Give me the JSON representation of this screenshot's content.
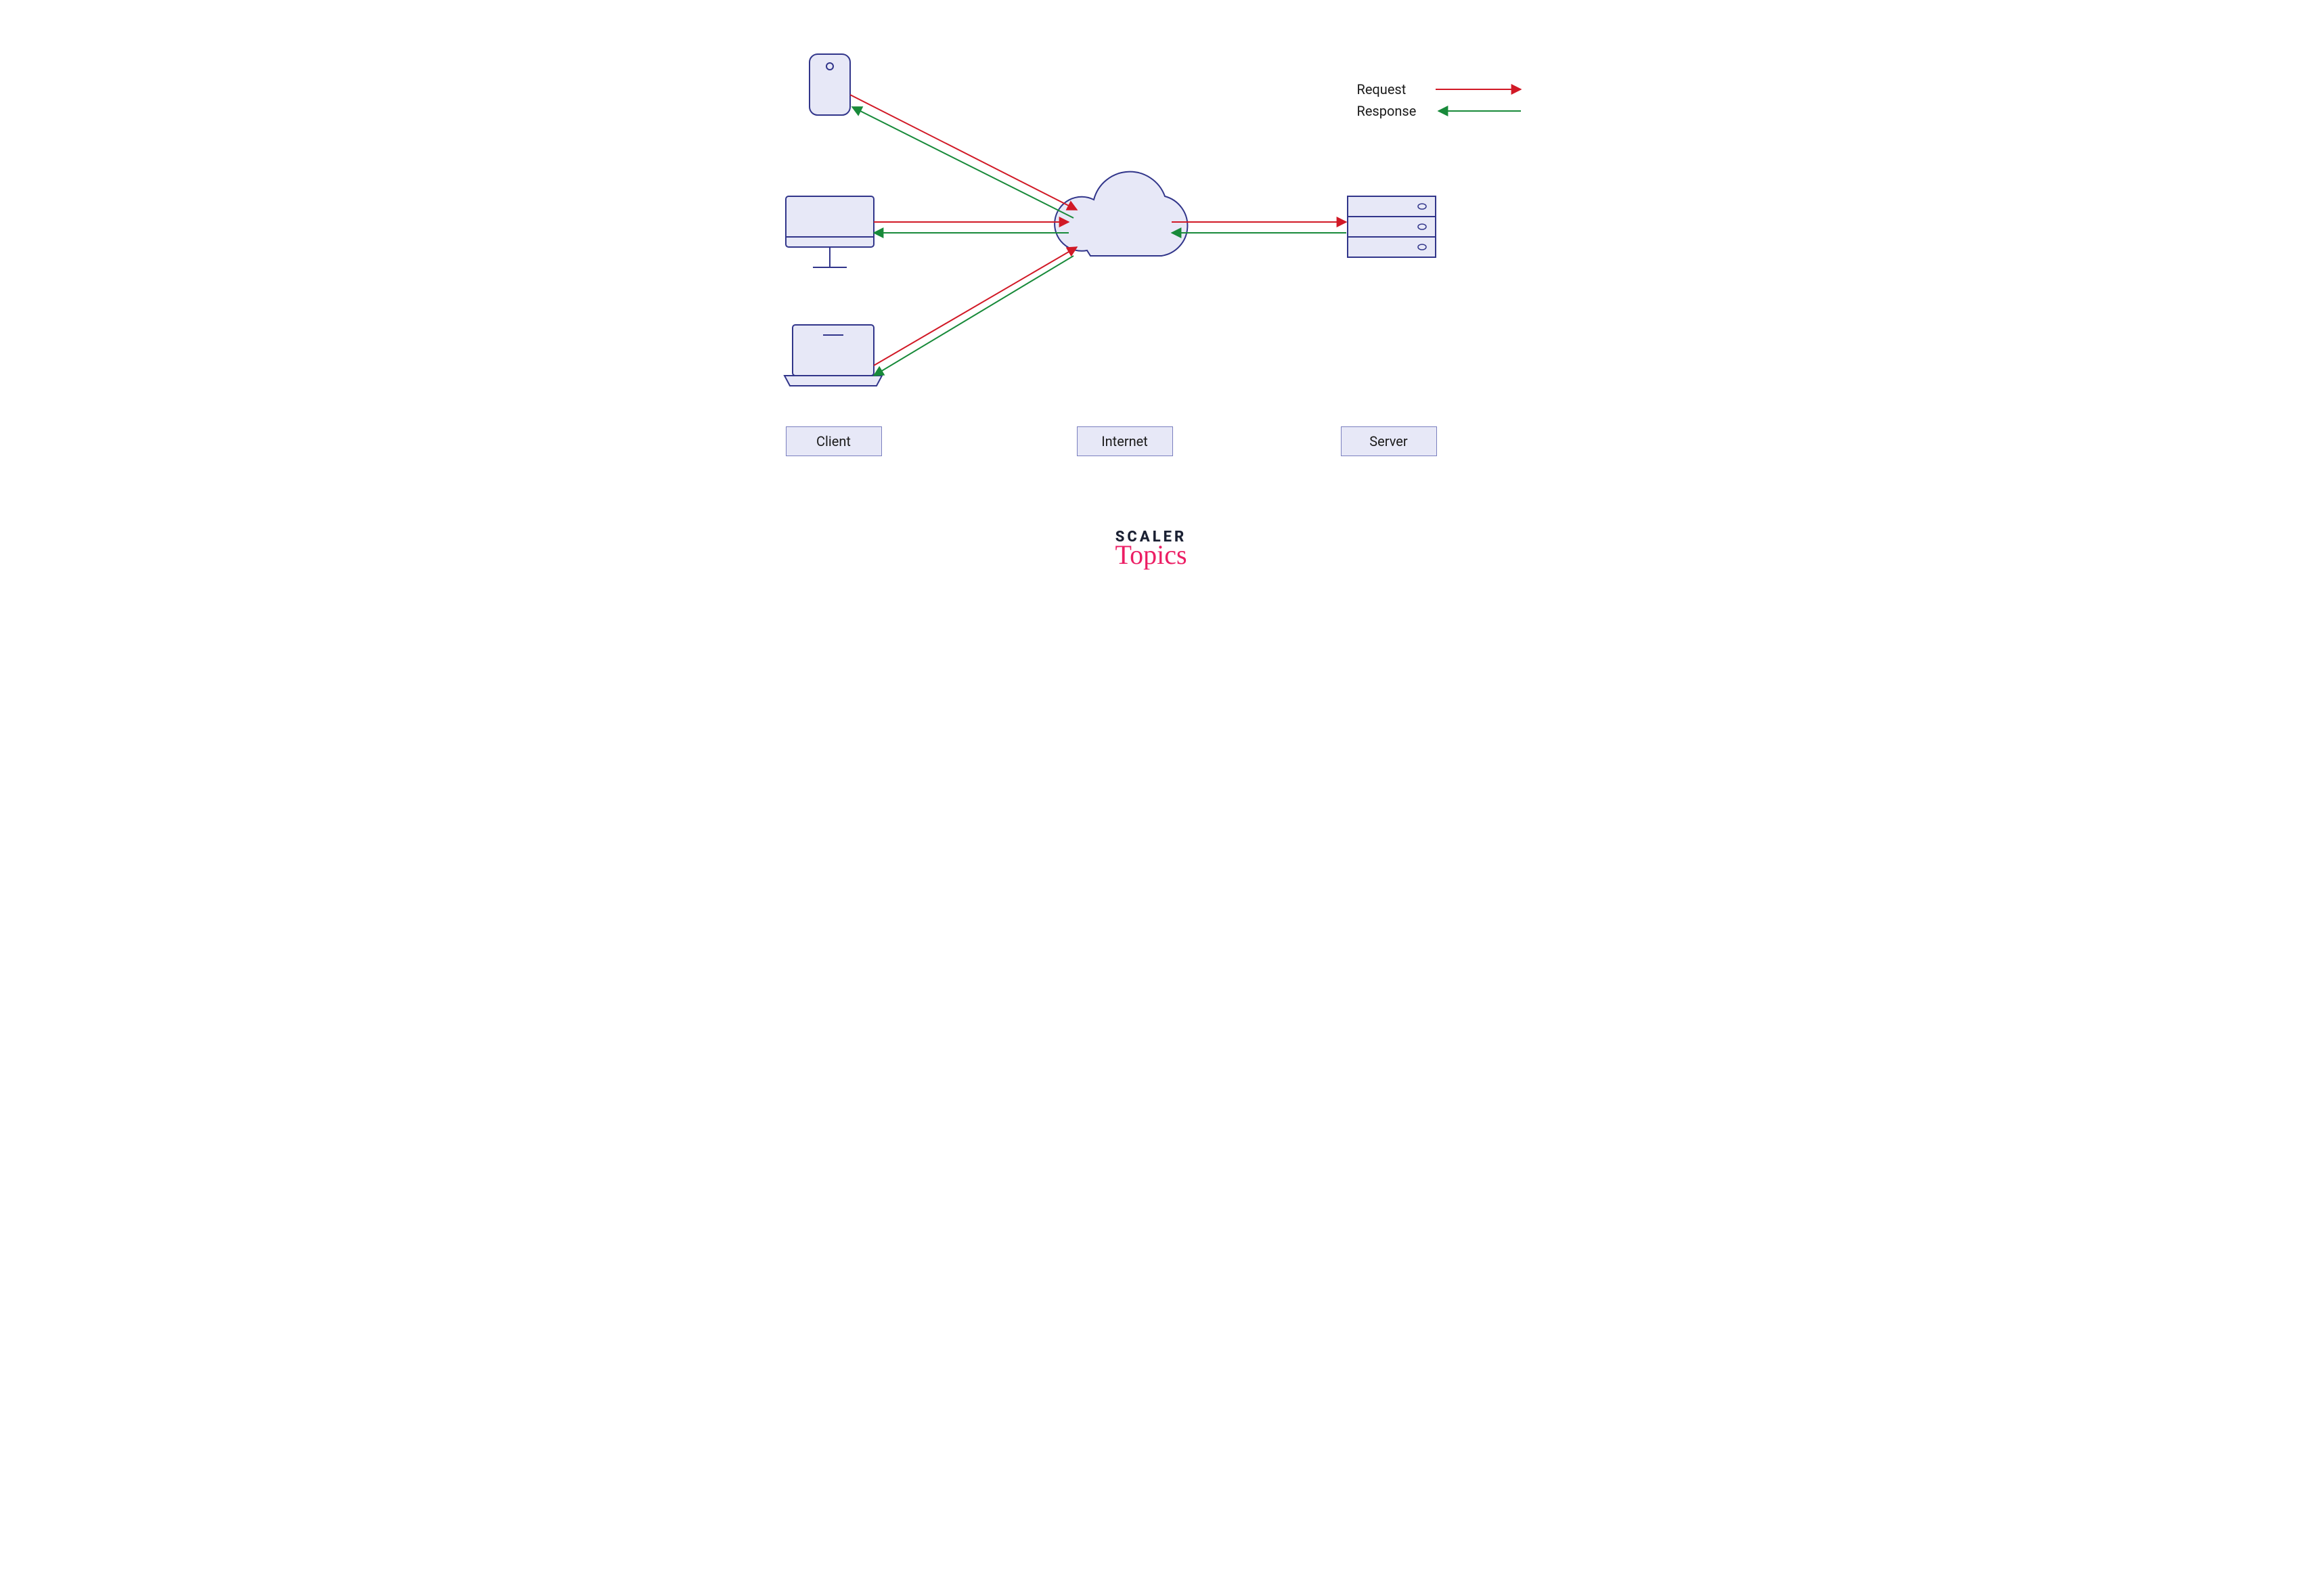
{
  "labels": {
    "client": "Client",
    "internet": "Internet",
    "server": "Server"
  },
  "legend": {
    "request": "Request",
    "response": "Response"
  },
  "logo": {
    "line1": "SCALER",
    "line2": "Topics"
  },
  "colors": {
    "stroke": "#31358a",
    "fill": "#e7e8f7",
    "request": "#d11926",
    "response": "#188a3a"
  },
  "diagram": {
    "nodes": {
      "clients": [
        "phone",
        "desktop",
        "laptop"
      ],
      "middle": "cloud",
      "server": "server-rack"
    },
    "edges": [
      {
        "from": "phone",
        "to": "cloud",
        "type": "request"
      },
      {
        "from": "cloud",
        "to": "phone",
        "type": "response"
      },
      {
        "from": "desktop",
        "to": "cloud",
        "type": "request"
      },
      {
        "from": "cloud",
        "to": "desktop",
        "type": "response"
      },
      {
        "from": "laptop",
        "to": "cloud",
        "type": "request"
      },
      {
        "from": "cloud",
        "to": "laptop",
        "type": "response"
      },
      {
        "from": "cloud",
        "to": "server",
        "type": "request"
      },
      {
        "from": "server",
        "to": "cloud",
        "type": "response"
      }
    ]
  }
}
